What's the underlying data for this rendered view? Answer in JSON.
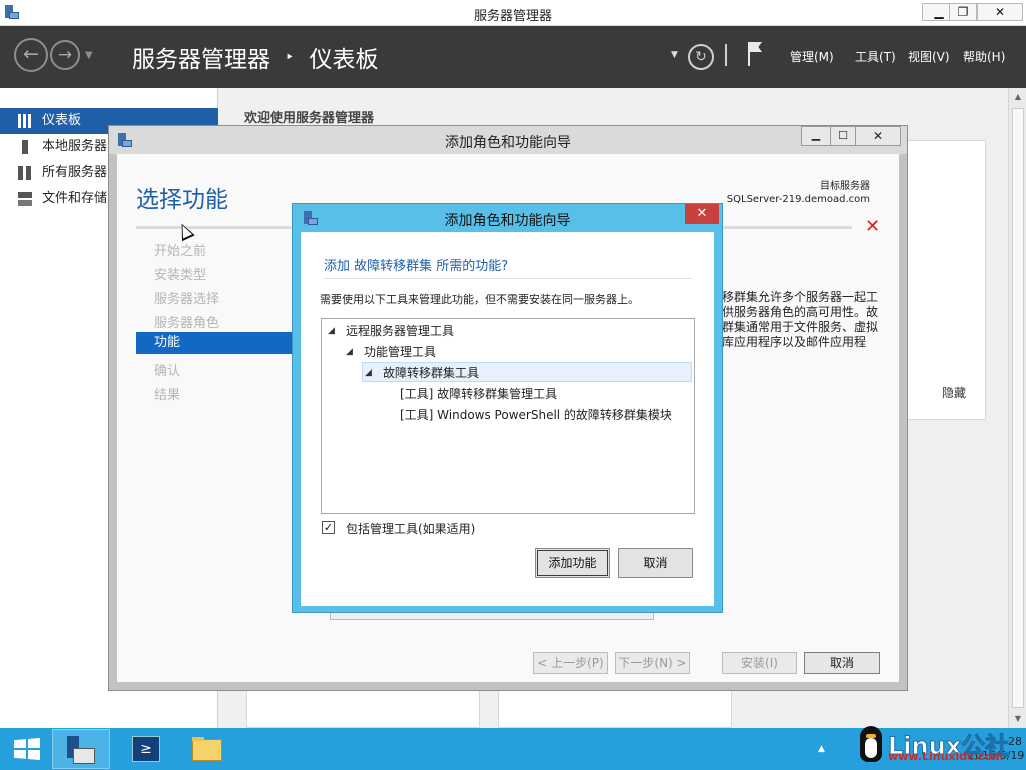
{
  "window": {
    "title": "服务器管理器",
    "minimize": "▁",
    "restore": "❐",
    "close": "✕"
  },
  "header": {
    "breadcrumb_app": "服务器管理器",
    "breadcrumb_sep": "‣",
    "breadcrumb_page": "仪表板",
    "menus": [
      "管理(M)",
      "工具(T)",
      "视图(V)",
      "帮助(H)"
    ]
  },
  "sidebar": {
    "items": [
      {
        "label": "仪表板",
        "icon": "dashboard-grid-icon",
        "selected": true
      },
      {
        "label": "本地服务器",
        "icon": "server-icon",
        "selected": false
      },
      {
        "label": "所有服务器",
        "icon": "servers-icon",
        "selected": false
      },
      {
        "label": "文件和存储",
        "icon": "storage-icon",
        "selected": false
      }
    ]
  },
  "dashboard": {
    "welcome": "欢迎使用服务器管理器"
  },
  "wizard": {
    "title": "添加角色和功能向导",
    "heading": "选择功能",
    "destination_label": "目标服务器",
    "destination_server": "SQLServer-219.demoad.com",
    "steps": [
      {
        "label": "开始之前",
        "selected": false
      },
      {
        "label": "安装类型",
        "selected": false
      },
      {
        "label": "服务器选择",
        "selected": false
      },
      {
        "label": "服务器角色",
        "selected": false
      },
      {
        "label": "功能",
        "selected": true
      },
      {
        "label": "确认",
        "selected": false
      },
      {
        "label": "结果",
        "selected": false
      }
    ],
    "description_lines": [
      "移群集允许多个服务器一起工",
      "供服务器角色的高可用性。故",
      "群集通常用于文件服务、虚拟",
      "库应用程序以及邮件应用程"
    ],
    "hide_label": "隐藏",
    "error_mark": "✕",
    "buttons": {
      "prev": "< 上一步(P)",
      "next": "下一步(N) >",
      "install": "安装(I)",
      "cancel": "取消"
    }
  },
  "dialog": {
    "title": "添加角色和功能向导",
    "close": "✕",
    "heading": "添加 故障转移群集 所需的功能?",
    "note": "需要使用以下工具来管理此功能，但不需要安装在同一服务器上。",
    "tree": [
      {
        "label": "远程服务器管理工具",
        "expander": "◢"
      },
      {
        "label": "功能管理工具",
        "expander": "◢"
      },
      {
        "label": "故障转移群集工具",
        "expander": "◢"
      },
      {
        "label": "[工具] 故障转移群集管理工具",
        "expander": ""
      },
      {
        "label": "[工具] Windows PowerShell 的故障转移群集模块",
        "expander": ""
      }
    ],
    "include_tools_label": "包括管理工具(如果适用)",
    "include_tools_checked": true,
    "checkmark": "✓",
    "buttons": {
      "add": "添加功能",
      "cancel": "取消"
    }
  },
  "taskbar": {
    "time": "28",
    "date": "2016/5/19"
  },
  "watermark": {
    "brand": "Linux公社",
    "url": "www.Linuxidc.com"
  },
  "colors": {
    "header_bg": "#3a3a3a",
    "selection_blue": "#1f5fa7",
    "dialog_border": "#58c0e8",
    "taskbar": "#25a0dc",
    "error_red": "#d42424"
  }
}
